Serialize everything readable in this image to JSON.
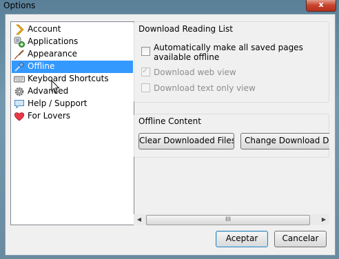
{
  "window": {
    "title": "Options",
    "close_glyph": "x"
  },
  "sidebar": {
    "items": [
      {
        "label": "Account",
        "icon": "account-chevron-icon",
        "selected": false
      },
      {
        "label": "Applications",
        "icon": "applications-icon",
        "selected": false
      },
      {
        "label": "Appearance",
        "icon": "appearance-brush-icon",
        "selected": false
      },
      {
        "label": "Offline",
        "icon": "offline-icon",
        "selected": true
      },
      {
        "label": "Keyboard Shortcuts",
        "icon": "keyboard-icon",
        "selected": false
      },
      {
        "label": "Advanced",
        "icon": "gear-icon",
        "selected": false
      },
      {
        "label": "Help / Support",
        "icon": "speech-bubble-icon",
        "selected": false
      },
      {
        "label": "For Lovers",
        "icon": "heart-icon",
        "selected": false
      }
    ]
  },
  "download_reading_list": {
    "title": "Download Reading List",
    "auto_save": {
      "label": "Automatically make all saved pages available offline",
      "checked": false
    },
    "web_view": {
      "label": "Download web view",
      "checked": true,
      "disabled": true
    },
    "text_only": {
      "label": "Download text only view",
      "checked": false,
      "disabled": true
    }
  },
  "offline_content": {
    "title": "Offline Content",
    "clear_button": "Clear Downloaded Files",
    "change_button": "Change Download Directory"
  },
  "scrollbar": {
    "grip": "III"
  },
  "footer": {
    "ok": "Aceptar",
    "cancel": "Cancelar"
  }
}
